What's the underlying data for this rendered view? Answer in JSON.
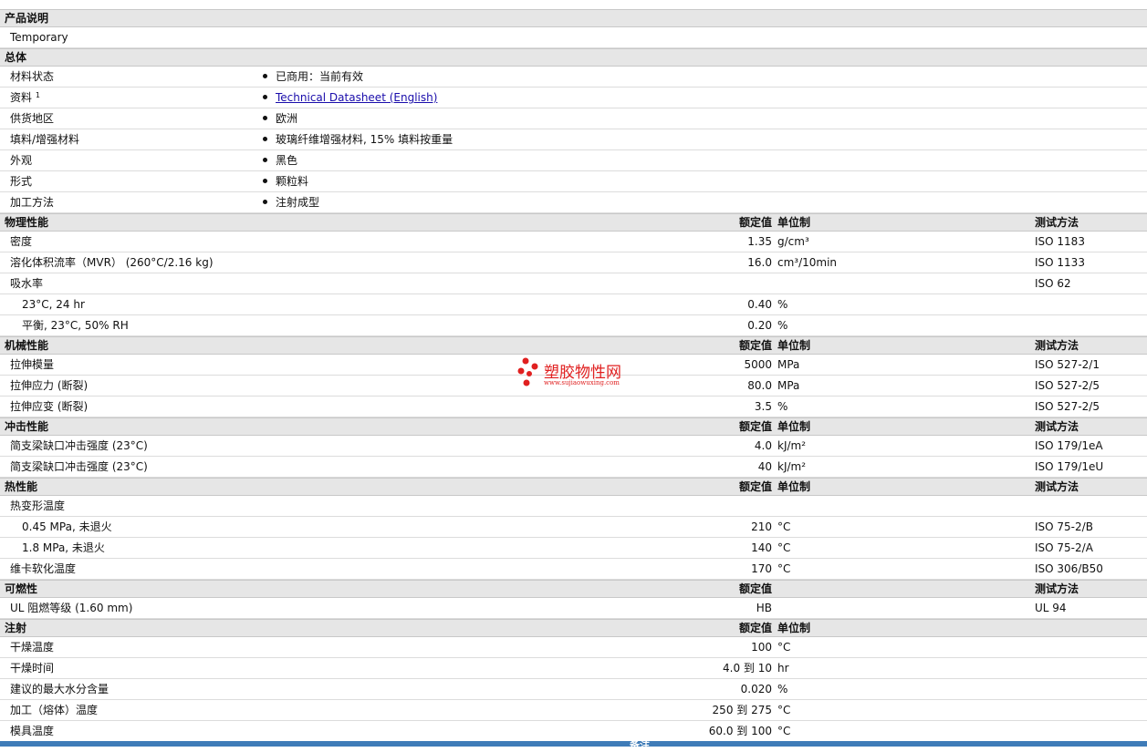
{
  "sections": [
    {
      "title": "产品说明",
      "headers": {
        "value": "",
        "unit": "",
        "test": ""
      },
      "rows": [
        {
          "label": "Temporary",
          "indent": false
        }
      ]
    },
    {
      "title": "总体",
      "headers": {
        "value": "",
        "unit": "",
        "test": ""
      },
      "rows": [
        {
          "label": "材料状态",
          "bullet": "已商用：当前有效"
        },
        {
          "label": "资料",
          "sup": "1",
          "bullet": "Technical Datasheet (English)",
          "link": true
        },
        {
          "label": "供货地区",
          "bullet": "欧洲"
        },
        {
          "label": "填料/增强材料",
          "bullet": "玻璃纤维增强材料, 15% 填料按重量"
        },
        {
          "label": "外观",
          "bullet": "黑色"
        },
        {
          "label": "形式",
          "bullet": "颗粒料"
        },
        {
          "label": "加工方法",
          "bullet": "注射成型"
        }
      ]
    },
    {
      "title": "物理性能",
      "headers": {
        "value": "额定值",
        "unit": "单位制",
        "test": "测试方法"
      },
      "rows": [
        {
          "label": "密度",
          "value": "1.35",
          "unit": "g/cm³",
          "test": "ISO 1183"
        },
        {
          "label": "溶化体积流率（MVR） (260°C/2.16 kg)",
          "value": "16.0",
          "unit": "cm³/10min",
          "test": "ISO 1133"
        },
        {
          "label": "吸水率",
          "test": "ISO 62"
        },
        {
          "label": "23°C, 24 hr",
          "indent": true,
          "value": "0.40",
          "unit": "%"
        },
        {
          "label": "平衡, 23°C, 50% RH",
          "indent": true,
          "value": "0.20",
          "unit": "%"
        }
      ]
    },
    {
      "title": "机械性能",
      "headers": {
        "value": "额定值",
        "unit": "单位制",
        "test": "测试方法"
      },
      "rows": [
        {
          "label": "拉伸模量",
          "value": "5000",
          "unit": "MPa",
          "test": "ISO 527-2/1"
        },
        {
          "label": "拉伸应力 (断裂)",
          "value": "80.0",
          "unit": "MPa",
          "test": "ISO 527-2/5"
        },
        {
          "label": "拉伸应变 (断裂)",
          "value": "3.5",
          "unit": "%",
          "test": "ISO 527-2/5"
        }
      ]
    },
    {
      "title": "冲击性能",
      "headers": {
        "value": "额定值",
        "unit": "单位制",
        "test": "测试方法"
      },
      "rows": [
        {
          "label": "简支梁缺口冲击强度 (23°C)",
          "value": "4.0",
          "unit": "kJ/m²",
          "test": "ISO 179/1eA"
        },
        {
          "label": "简支梁缺口冲击强度 (23°C)",
          "value": "40",
          "unit": "kJ/m²",
          "test": "ISO 179/1eU"
        }
      ]
    },
    {
      "title": "热性能",
      "headers": {
        "value": "额定值",
        "unit": "单位制",
        "test": "测试方法"
      },
      "rows": [
        {
          "label": "热变形温度"
        },
        {
          "label": "0.45 MPa, 未退火",
          "indent": true,
          "value": "210",
          "unit": "°C",
          "test": "ISO 75-2/B"
        },
        {
          "label": "1.8 MPa, 未退火",
          "indent": true,
          "value": "140",
          "unit": "°C",
          "test": "ISO 75-2/A"
        },
        {
          "label": "维卡软化温度",
          "value": "170",
          "unit": "°C",
          "test": "ISO 306/B50"
        }
      ]
    },
    {
      "title": "可燃性",
      "headers": {
        "value": "额定值",
        "unit": "",
        "test": "测试方法"
      },
      "rows": [
        {
          "label": "UL 阻燃等级 (1.60 mm)",
          "value": "HB",
          "test": "UL 94"
        }
      ]
    },
    {
      "title": "注射",
      "headers": {
        "value": "额定值",
        "unit": "单位制",
        "test": ""
      },
      "rows": [
        {
          "label": "干燥温度",
          "value": "100",
          "unit": "°C"
        },
        {
          "label": "干燥时间",
          "value": "4.0 到  10",
          "unit": "hr"
        },
        {
          "label": "建议的最大水分含量",
          "value": "0.020",
          "unit": "%"
        },
        {
          "label": "加工（熔体）温度",
          "value": "250 到  275",
          "unit": "°C"
        },
        {
          "label": "模具温度",
          "value": "60.0 到  100",
          "unit": "°C"
        }
      ]
    }
  ],
  "watermark": {
    "name": "塑胶物性网",
    "url": "www.sujiaowuxing.com",
    "color": "#e02020"
  },
  "footer": {
    "label": "备注"
  }
}
